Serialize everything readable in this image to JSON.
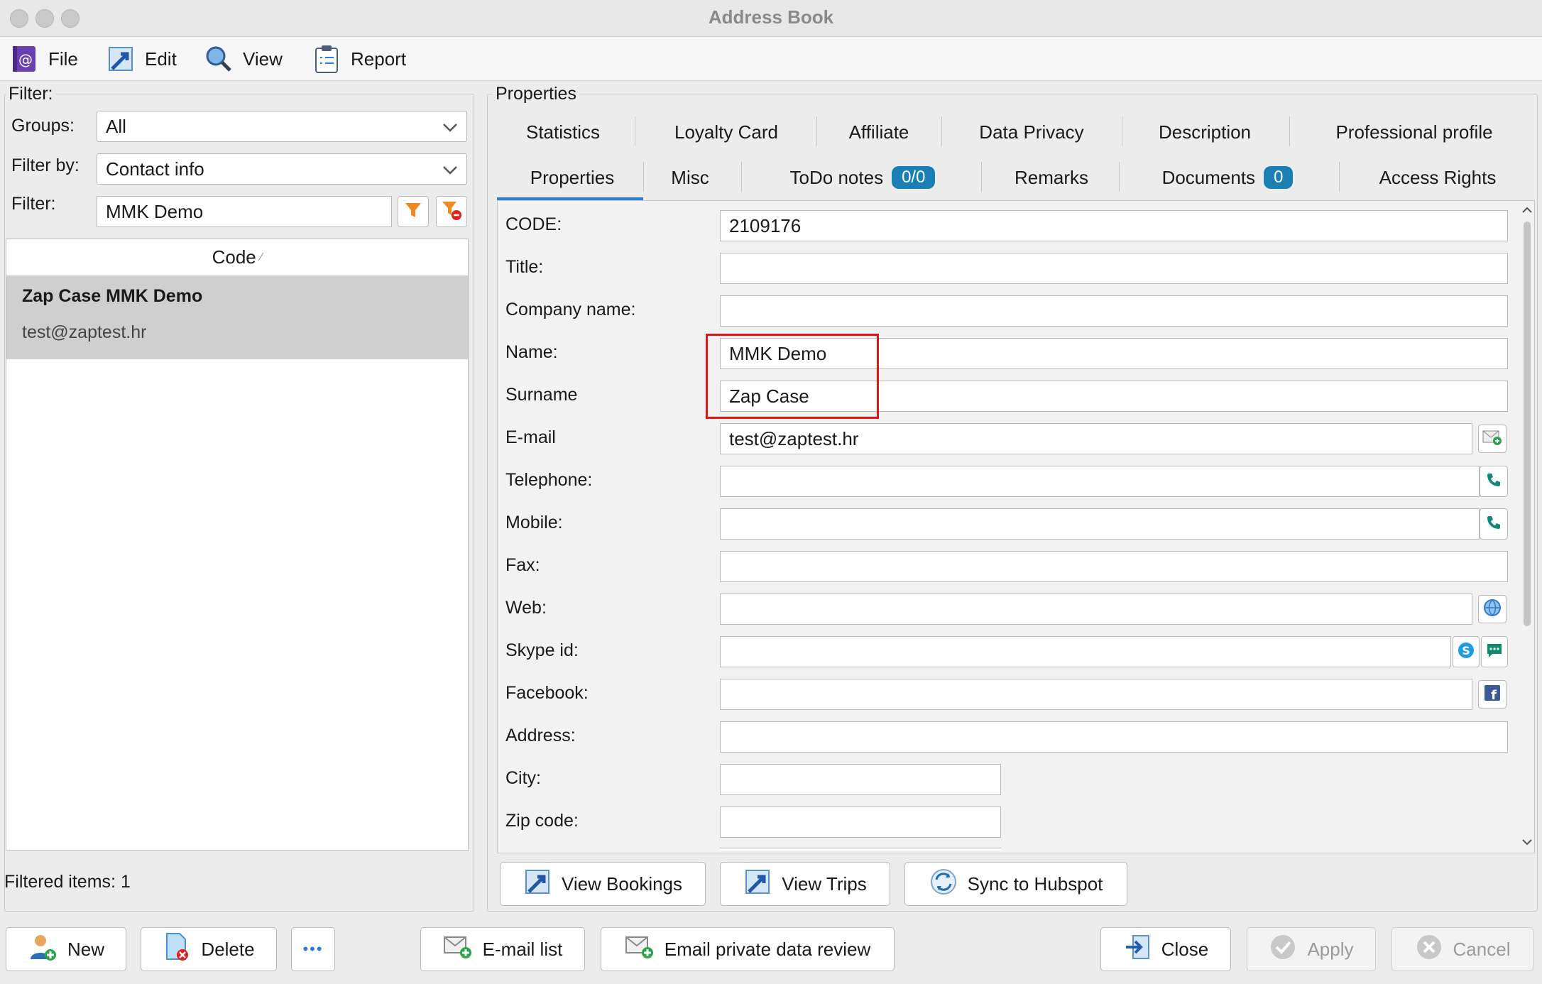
{
  "window": {
    "title": "Address Book"
  },
  "menu": [
    {
      "label": "File",
      "icon": "address-book-icon"
    },
    {
      "label": "Edit",
      "icon": "edit-arrow-icon"
    },
    {
      "label": "View",
      "icon": "magnifier-icon"
    },
    {
      "label": "Report",
      "icon": "clipboard-icon"
    }
  ],
  "filter": {
    "legend": "Filter:",
    "groups_label": "Groups:",
    "groups_value": "All",
    "filter_by_label": "Filter by:",
    "filter_by_value": "Contact info",
    "filter_label": "Filter:",
    "filter_value": "MMK Demo"
  },
  "list": {
    "column_header": "Code",
    "sort_glyph": "⁄",
    "rows": [
      {
        "name": "Zap Case MMK Demo",
        "email": "test@zaptest.hr"
      }
    ],
    "filtered_label": "Filtered items:",
    "filtered_count": "1"
  },
  "properties": {
    "legend": "Properties",
    "tabs_row1": [
      "Statistics",
      "Loyalty Card",
      "Affiliate",
      "Data Privacy",
      "Description",
      "Professional profile"
    ],
    "tabs_row2": [
      {
        "label": "Properties",
        "badge": ""
      },
      {
        "label": "Misc",
        "badge": ""
      },
      {
        "label": "ToDo notes",
        "badge": "0/0"
      },
      {
        "label": "Remarks",
        "badge": ""
      },
      {
        "label": "Documents",
        "badge": "0"
      },
      {
        "label": "Access Rights",
        "badge": ""
      }
    ],
    "active_tab": "Properties",
    "fields": {
      "code": {
        "label": "CODE:",
        "value": "2109176"
      },
      "title": {
        "label": "Title:",
        "value": ""
      },
      "company": {
        "label": "Company name:",
        "value": ""
      },
      "name": {
        "label": "Name:",
        "value": "MMK Demo"
      },
      "surname": {
        "label": "Surname",
        "value": "Zap Case"
      },
      "email": {
        "label": "E-mail",
        "value": "test@zaptest.hr"
      },
      "telephone": {
        "label": "Telephone:",
        "value": ""
      },
      "mobile": {
        "label": "Mobile:",
        "value": ""
      },
      "fax": {
        "label": "Fax:",
        "value": ""
      },
      "web": {
        "label": "Web:",
        "value": ""
      },
      "skype": {
        "label": "Skype id:",
        "value": ""
      },
      "facebook": {
        "label": "Facebook:",
        "value": ""
      },
      "address": {
        "label": "Address:",
        "value": ""
      },
      "city": {
        "label": "City:",
        "value": ""
      },
      "zip": {
        "label": "Zip code:",
        "value": ""
      }
    },
    "actions": {
      "view_bookings": "View Bookings",
      "view_trips": "View Trips",
      "sync_hubspot": "Sync to Hubspot"
    }
  },
  "footer": {
    "new": "New",
    "delete": "Delete",
    "more": "•••",
    "email_list": "E-mail list",
    "email_private": "Email private data review",
    "close": "Close",
    "apply": "Apply",
    "cancel": "Cancel"
  },
  "colors": {
    "accent_blue": "#1a7fb5",
    "highlight_red": "#e0161a",
    "filter_orange": "#f08a1c"
  }
}
